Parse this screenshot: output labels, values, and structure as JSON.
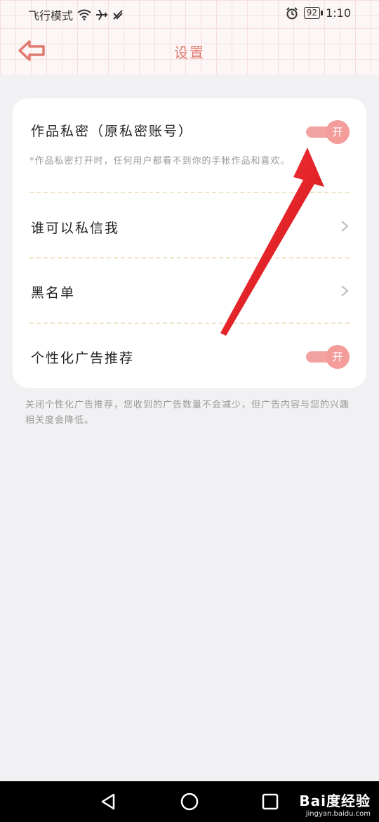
{
  "status_bar": {
    "mode": "飞行模式",
    "battery": "92",
    "time": "1:10"
  },
  "header": {
    "title": "设置"
  },
  "settings": {
    "private_works": {
      "label": "作品私密（原私密账号）",
      "note": "*作品私密打开时，任何用户都看不到你的手帐作品和喜欢。",
      "toggle_label": "开",
      "enabled": true
    },
    "who_can_message": {
      "label": "谁可以私信我"
    },
    "blacklist": {
      "label": "黑名单"
    },
    "personalized_ads": {
      "label": "个性化广告推荐",
      "toggle_label": "开",
      "enabled": true
    }
  },
  "footer_note": "关闭个性化广告推荐，您收到的广告数量不会减少，但广告内容与您的兴趣相关度会降低。",
  "watermark": {
    "brand": "Bai度经验",
    "url": "jingyan.baidu.com"
  },
  "colors": {
    "accent": "#e07a6e",
    "toggle": "#f49c9a",
    "annotation_arrow": "#e8202a"
  },
  "icons": {
    "back": "back-arrow-icon",
    "chevron": "chevron-right-icon",
    "wifi": "wifi-icon",
    "airplane": "airplane-icon",
    "alarm": "alarm-icon"
  }
}
